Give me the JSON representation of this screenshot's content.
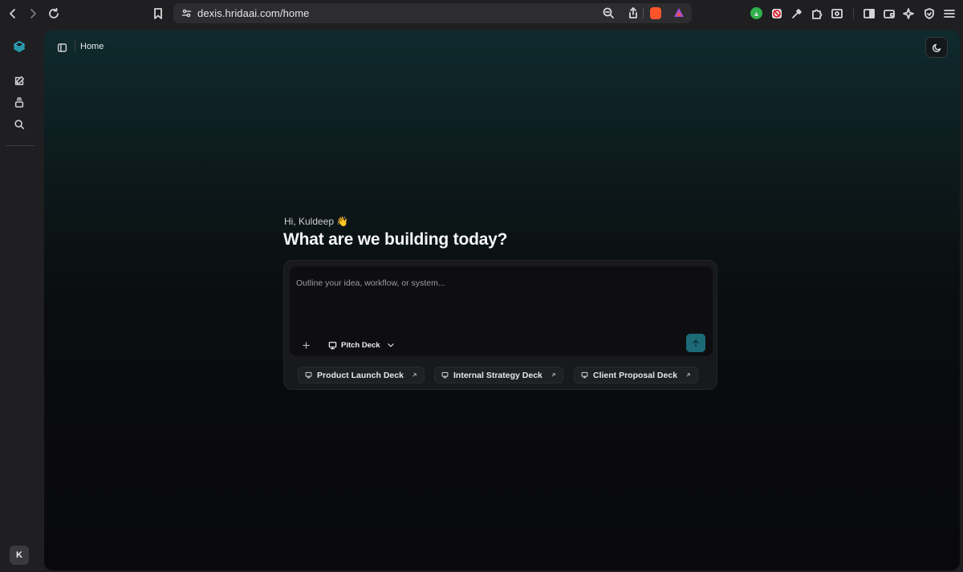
{
  "browser": {
    "url": "dexis.hridaai.com/home"
  },
  "app": {
    "breadcrumb": "Home",
    "avatar_initial": "K",
    "accent_color": "#1b6a76"
  },
  "hero": {
    "greeting": "Hi, Kuldeep 👋",
    "headline": "What are we building today?"
  },
  "composer": {
    "placeholder": "Outline your idea, workflow, or system...",
    "mode_label": "Pitch Deck"
  },
  "suggestions": [
    {
      "label": "Product Launch Deck"
    },
    {
      "label": "Internal Strategy Deck"
    },
    {
      "label": "Client Proposal Deck"
    }
  ]
}
